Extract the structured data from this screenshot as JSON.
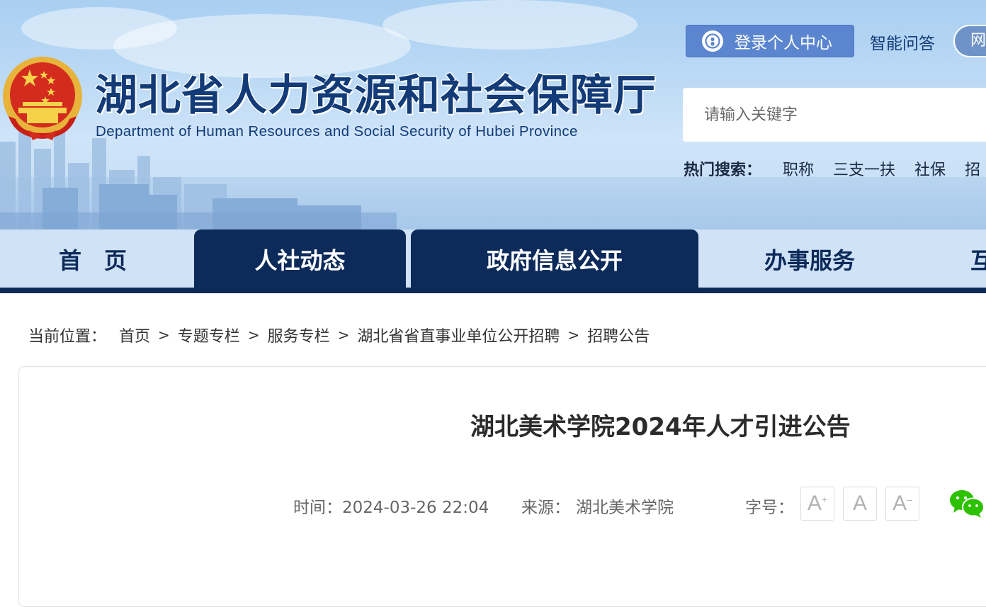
{
  "header": {
    "title": "湖北省人力资源和社会保障厅",
    "subtitle": "Department of Human Resources and Social Security of Hubei Province",
    "login_label": "登录个人中心",
    "smart_qa_label": "智能问答",
    "net_label": "网",
    "search_placeholder": "请输入关键字",
    "hot_search_label": "热门搜索：",
    "hot_search_items": [
      "职称",
      "三支一扶",
      "社保",
      "招"
    ]
  },
  "nav": {
    "items": [
      "首　页",
      "人社动态",
      "政府信息公开",
      "办事服务",
      "互"
    ]
  },
  "breadcrumb": {
    "label": "当前位置：",
    "items": [
      "首页",
      "专题专栏",
      "服务专栏",
      "湖北省省直事业单位公开招聘",
      "招聘公告"
    ],
    "separator": ">"
  },
  "article": {
    "title": "湖北美术学院2024年人才引进公告",
    "time_label": "时间：",
    "time_value": "2024-03-26 22:04",
    "source_label": "来源：",
    "source_value": "湖北美术学院",
    "font_size_label": "字号：",
    "font_buttons": [
      "A+",
      "A",
      "A-"
    ]
  },
  "icons": {
    "login": "user-icon",
    "share": "wechat-icon"
  },
  "colors": {
    "brand_navy": "#0d2b5a",
    "login_blue": "#5b86cf",
    "nav_light": "#cfe2f6",
    "wechat_green": "#2dc100"
  }
}
